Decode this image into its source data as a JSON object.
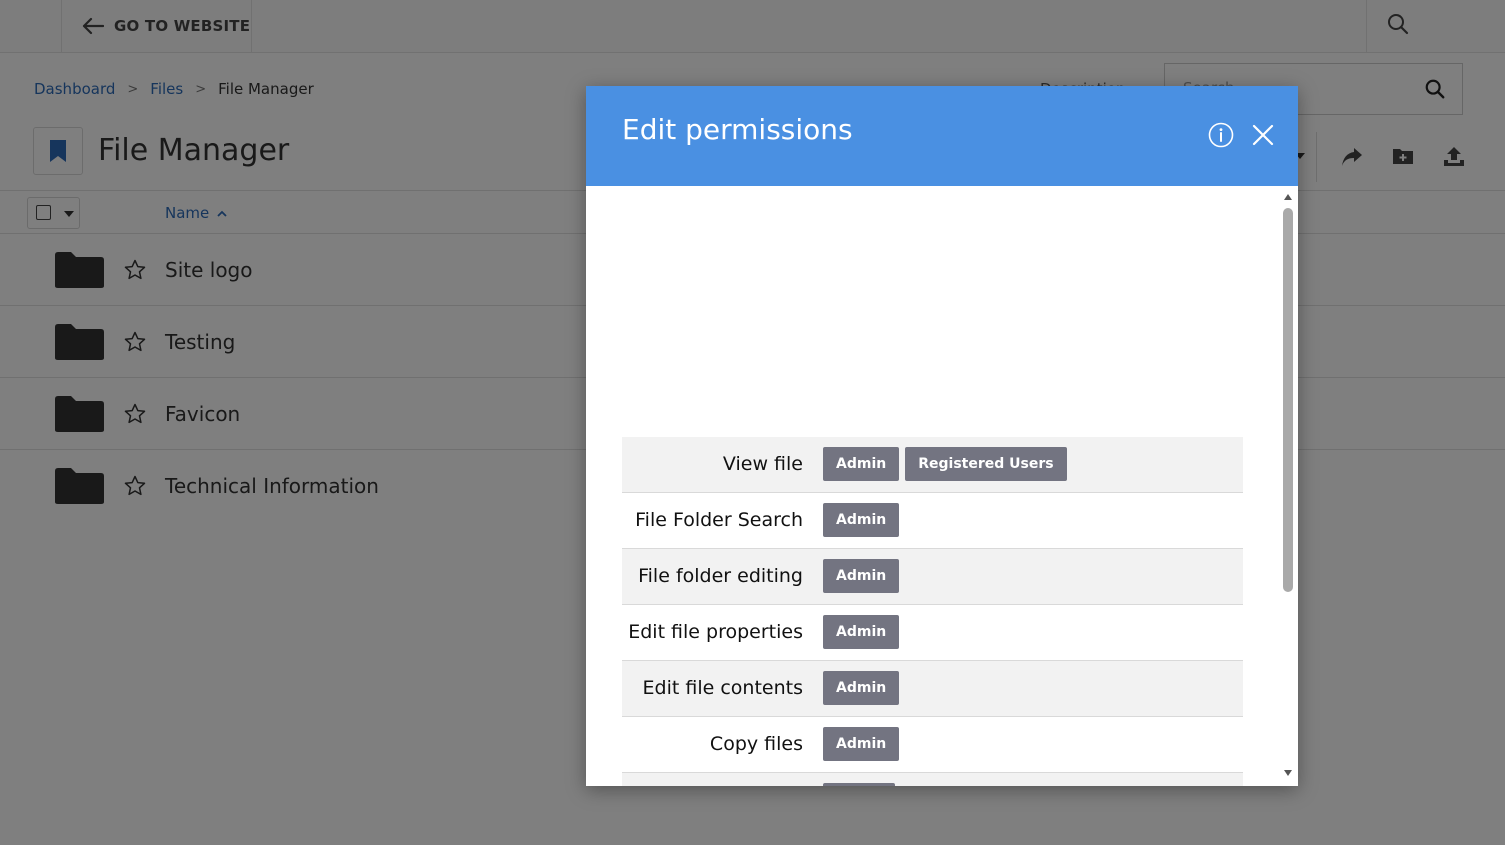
{
  "topbar": {
    "go_website_label": "GO TO WEBSITE"
  },
  "breadcrumb": {
    "items": [
      "Dashboard",
      "Files",
      "File Manager"
    ],
    "separator": ">"
  },
  "header": {
    "description_label": "Description",
    "search_placeholder": "Search",
    "page_title": "File Manager"
  },
  "list": {
    "name_column": "Name",
    "rows": [
      "Site logo",
      "Testing",
      "Favicon",
      "Technical Information"
    ]
  },
  "modal": {
    "title": "Edit permissions",
    "permissions": [
      {
        "label": "View file",
        "roles": [
          "Admin",
          "Registered Users"
        ]
      },
      {
        "label": "File Folder Search",
        "roles": [
          "Admin"
        ]
      },
      {
        "label": "File folder editing",
        "roles": [
          "Admin"
        ]
      },
      {
        "label": "Edit file properties",
        "roles": [
          "Admin"
        ]
      },
      {
        "label": "Edit file contents",
        "roles": [
          "Admin"
        ]
      },
      {
        "label": "Copy files",
        "roles": [
          "Admin"
        ]
      }
    ]
  },
  "colors": {
    "modal_header": "#4a90e2",
    "badge": "#737481",
    "link": "#2d6bb8"
  }
}
